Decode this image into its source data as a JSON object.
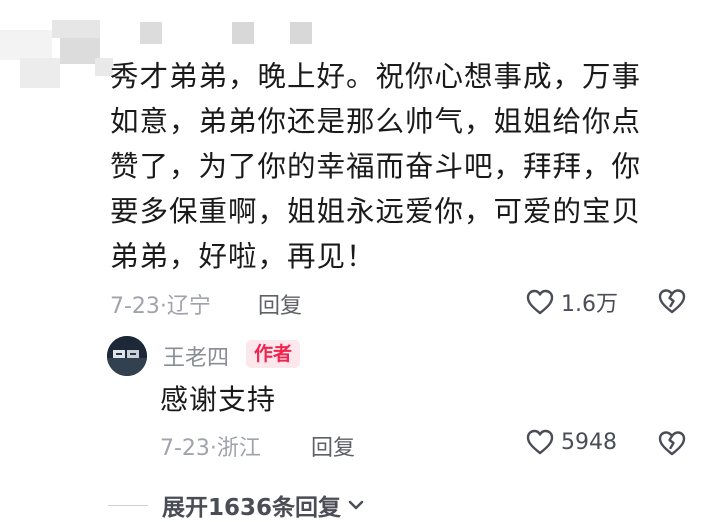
{
  "comment": {
    "body": "秀才弟弟，晚上好。祝你心想事成，万事如意，弟弟你还是那么帅气，姐姐给你点赞了，为了你的幸福而奋斗吧，拜拜，你要多保重啊，姐姐永远爱你，可爱的宝贝弟弟，好啦，再见！",
    "time_location": "7-23·辽宁",
    "reply_label": "回复",
    "like_count": "1.6万"
  },
  "reply": {
    "username": "王老四",
    "author_badge": "作者",
    "body": "感谢支持",
    "time_location": "7-23·浙江",
    "reply_label": "回复",
    "like_count": "5948"
  },
  "expand_label": "展开1636条回复",
  "icons": {
    "like": "heart-outline-icon",
    "dislike": "broken-heart-icon",
    "expand": "chevron-down-icon"
  }
}
